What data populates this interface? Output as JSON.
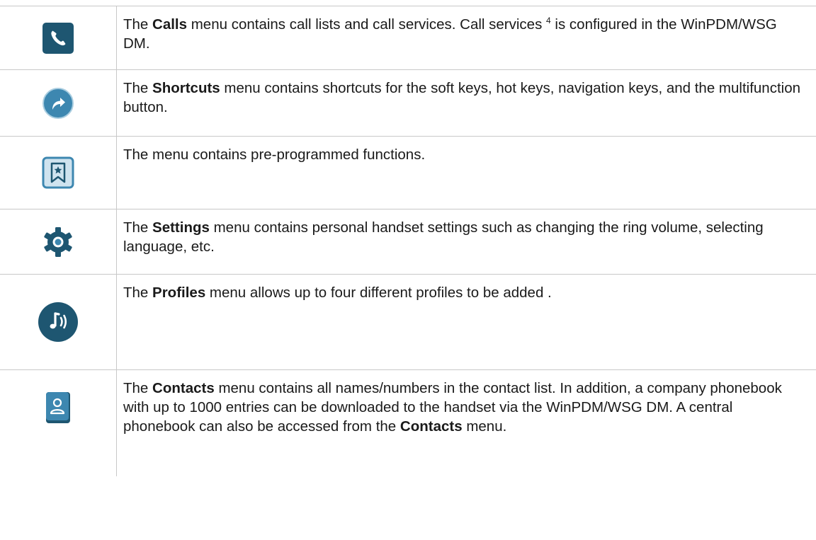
{
  "rows": [
    {
      "icon": "phone-icon",
      "pre": "The ",
      "bold": "Calls",
      "post": " menu contains call lists and call services. Call services ",
      "sup": "4",
      "post2": " is configured in the WinPDM/WSG DM."
    },
    {
      "icon": "shortcut-arrow-icon",
      "pre": "The ",
      "bold": "Shortcuts",
      "post": " menu contains shortcuts for the soft keys, hot keys, navigation keys, and the multifunction button."
    },
    {
      "icon": "bookmark-star-icon",
      "text": "The menu contains pre-programmed functions."
    },
    {
      "icon": "gear-icon",
      "pre": "The ",
      "bold": "Settings",
      "post": " menu contains personal handset settings such as changing the ring volume, selecting language, etc."
    },
    {
      "icon": "music-note-sound-icon",
      "pre": "The ",
      "bold": "Profiles",
      "post": " menu allows up to four different profiles to be added ."
    },
    {
      "icon": "contacts-book-icon",
      "pre": "The ",
      "bold": "Contacts",
      "post": " menu contains all names/numbers in the contact list. In addition, a company phonebook with up to 1000 entries can be downloaded to the handset via the WinPDM/WSG DM. A central phonebook can also be accessed from the ",
      "bold2": "Contacts",
      "post2": " menu."
    }
  ],
  "colors": {
    "icon_dark": "#1e5671",
    "icon_mid": "#3d87b0",
    "icon_light": "#cfe3ef",
    "border": "#c8c8c8"
  }
}
